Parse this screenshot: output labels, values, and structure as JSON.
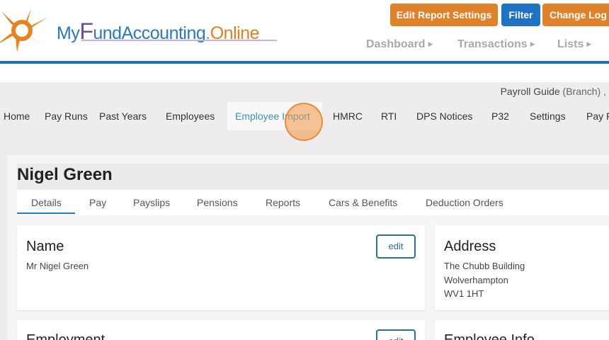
{
  "logo": {
    "my": "My",
    "f": "F",
    "und_accounting": "undAccounting",
    "dot": ".",
    "online": "Online"
  },
  "header_buttons": {
    "edit_report_settings": "Edit Report Settings",
    "filter": "Filter",
    "change_log": "Change Log"
  },
  "top_nav": {
    "dashboard": "Dashboard",
    "transactions": "Transactions",
    "lists": "Lists"
  },
  "branch": {
    "name": "Payroll Guide",
    "suffix": "(Branch) ,"
  },
  "payroll_nav": {
    "home": "Home",
    "pay_runs": "Pay Runs",
    "past_years": "Past Years",
    "employees": "Employees",
    "employee_import": "Employee Import",
    "hmrc": "HMRC",
    "rti": "RTI",
    "dps_notices": "DPS Notices",
    "p32": "P32",
    "settings": "Settings",
    "pay_f": "Pay F"
  },
  "employee": {
    "name": "Nigel Green"
  },
  "tabs": {
    "details": "Details",
    "pay": "Pay",
    "payslips": "Payslips",
    "pensions": "Pensions",
    "reports": "Reports",
    "cars_benefits": "Cars & Benefits",
    "deduction_orders": "Deduction Orders"
  },
  "name_card": {
    "title": "Name",
    "value": "Mr Nigel Green",
    "edit_label": "edit"
  },
  "address_card": {
    "title": "Address",
    "line1": "The Chubb Building",
    "line2": "Wolverhampton",
    "line3": "WV1 1HT"
  },
  "employment_card": {
    "title": "Employment",
    "edit_label": "edit"
  },
  "employee_info_card": {
    "title": "Employee Info"
  },
  "icons": {
    "caret": "right-caret-icon",
    "logo_mark": "sun-logo-icon"
  },
  "colors": {
    "orange": "#e0822a",
    "blue": "#1f72c4",
    "accent_blue": "#1f6fb5"
  }
}
